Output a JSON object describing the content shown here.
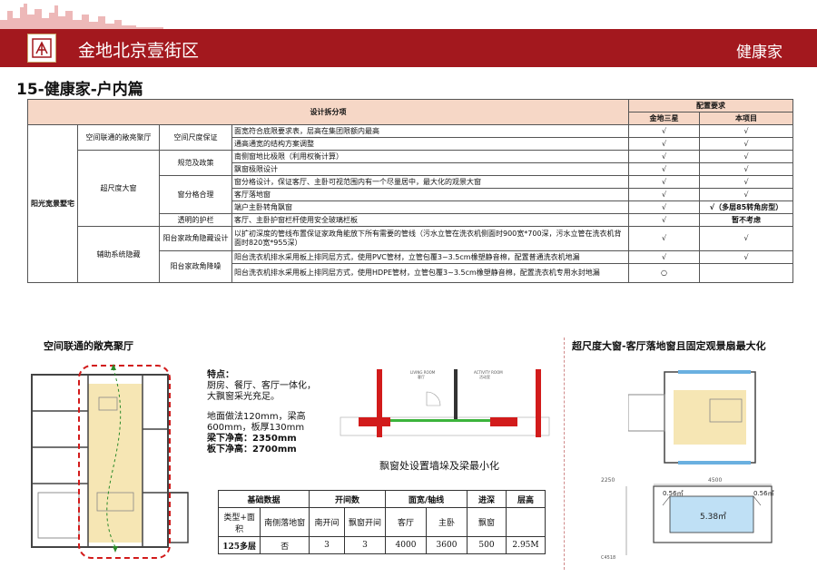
{
  "header": {
    "project": "金地北京壹街区",
    "brand": "健康家"
  },
  "page_title": "15-健康家-户内篇",
  "table": {
    "head_design": "设计拆分项",
    "head_config": "配置要求",
    "head_col1": "金地三星",
    "head_col2": "本项目",
    "category": "阳光宽景墅宅",
    "group1": "空间联通的敞亮聚厅",
    "group2": "超尺度大窗",
    "group3": "辅助系统隐藏",
    "sub1": "空间尺度保证",
    "sub2": "规范及政策",
    "sub3": "窗分格合理",
    "sub4": "透明的护栏",
    "sub5": "阳台家政角隐藏设计",
    "sub6": "阳台家政角降噪",
    "rows": [
      {
        "text": "面宽符合底限要求表，层高在集团限额内最高",
        "a": "√",
        "b": "√"
      },
      {
        "text": "通高通宽的结构方案调整",
        "a": "√",
        "b": "√"
      },
      {
        "text": "南侧窗地比极限（利用权衡计算）",
        "a": "√",
        "b": "√"
      },
      {
        "text": "飘窗极限设计",
        "a": "√",
        "b": "√"
      },
      {
        "text": "窗分格设计，保证客厅、主卧可视范围内有一个尽量居中，最大化的观景大窗",
        "a": "√",
        "b": "√"
      },
      {
        "text": "客厅落地窗",
        "a": "√",
        "b": "√"
      },
      {
        "text": "端户主卧转角飘窗",
        "a": "√",
        "b": "√（多层85转角房型）"
      },
      {
        "text": "客厅、主卧护窗栏杆使用安全玻璃栏板",
        "a": "√",
        "b": "暂不考虑"
      },
      {
        "text": "以扩初深度的管线布置保证家政角能放下所有需要的管线（污水立管在洗衣机侧面时900宽*700深，污水立管在洗衣机背面时820宽*955深）",
        "a": "√",
        "b": "√"
      },
      {
        "text": "阳台洗衣机排水采用板上排同层方式，使用PVC管材，立管包覆3~3.5cm橡塑静音棉，配置普通洗衣机地漏",
        "a": "√",
        "b": "√"
      },
      {
        "text": "阳台洗衣机排水采用板上排同层方式，使用HDPE管材，立管包覆3~3.5cm橡塑静音棉，配置洗衣机专用水封地漏",
        "a": "○",
        "b": ""
      }
    ]
  },
  "left_section": {
    "title": "空间联通的敞亮聚厅"
  },
  "features": {
    "heading": "特点：",
    "line1": "厨房、餐厅、客厅一体化，",
    "line2": "大飘窗采光充足。",
    "line3": "地面做法120mm，梁高",
    "line4": "600mm，板厚130mm",
    "line5": "梁下净高：2350mm",
    "line6": "板下净高：2700mm"
  },
  "diagram_caption": "飘窗处设置墙垛及梁最小化",
  "diagram_labels": {
    "living1": "LIVING ROOM",
    "living2": "客厅",
    "activity1": "ACTIVITY ROOM",
    "activity2": "活动室"
  },
  "data_table": {
    "h1": "基础数据",
    "h2": "开间数",
    "h3": "面宽/轴线",
    "h4": "进深",
    "h5": "层高",
    "s1": "类型+面积",
    "s2": "南侧落地窗",
    "s3": "南开间",
    "s4": "飘窗开间",
    "s5": "客厅",
    "s6": "主卧",
    "s7": "飘窗",
    "v1": "125多层",
    "v2": "否",
    "v3": "3",
    "v4": "3",
    "v5": "4000",
    "v6": "3600",
    "v7": "500",
    "v8": "2.95M"
  },
  "right_section": {
    "title": "超尺度大窗-客厅落地窗且固定观景扇最大化"
  },
  "window_plan": {
    "dim_top": "4500",
    "dim_left": "2250",
    "area_left": "0.56㎡",
    "area_right": "0.56㎡",
    "area_center": "5.38㎡",
    "code": "C4518"
  },
  "colors": {
    "brand_red": "#a3181e",
    "table_head": "#f6d7c6"
  }
}
